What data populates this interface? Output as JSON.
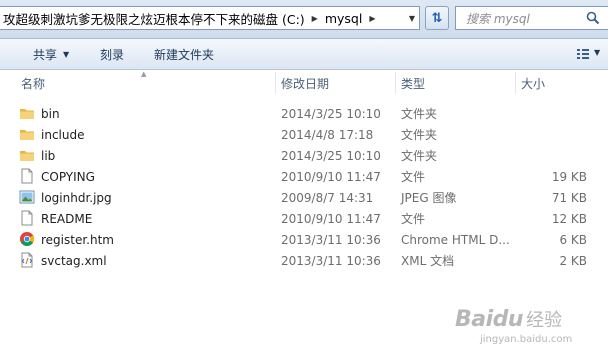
{
  "address_bar": {
    "breadcrumbs": [
      "攻超级刺激坑爹无极限之炫迈根本停不下来的磁盘 (C:)",
      "mysql"
    ]
  },
  "search": {
    "placeholder": "搜索 mysql"
  },
  "toolbar": {
    "share_label": "共享",
    "burn_label": "刻录",
    "new_folder_label": "新建文件夹"
  },
  "columns": {
    "name": "名称",
    "modified": "修改日期",
    "type": "类型",
    "size": "大小"
  },
  "files": [
    {
      "name": "bin",
      "modified": "2014/3/25 10:10",
      "type": "文件夹",
      "size": "",
      "icon": "folder-icon"
    },
    {
      "name": "include",
      "modified": "2014/4/8 17:18",
      "type": "文件夹",
      "size": "",
      "icon": "folder-icon"
    },
    {
      "name": "lib",
      "modified": "2014/3/25 10:10",
      "type": "文件夹",
      "size": "",
      "icon": "folder-icon"
    },
    {
      "name": "COPYING",
      "modified": "2010/9/10 11:47",
      "type": "文件",
      "size": "19 KB",
      "icon": "file-icon"
    },
    {
      "name": "loginhdr.jpg",
      "modified": "2009/8/7 14:31",
      "type": "JPEG 图像",
      "size": "71 KB",
      "icon": "image-file-icon"
    },
    {
      "name": "README",
      "modified": "2010/9/10 11:47",
      "type": "文件",
      "size": "12 KB",
      "icon": "file-icon"
    },
    {
      "name": "register.htm",
      "modified": "2013/3/11 10:36",
      "type": "Chrome HTML D...",
      "size": "6 KB",
      "icon": "chrome-icon"
    },
    {
      "name": "svctag.xml",
      "modified": "2013/3/11 10:36",
      "type": "XML 文档",
      "size": "2 KB",
      "icon": "xml-file-icon"
    }
  ],
  "watermark": {
    "brand": "Baidu",
    "brand_cn": "经验",
    "url": "jingyan.baidu.com"
  }
}
